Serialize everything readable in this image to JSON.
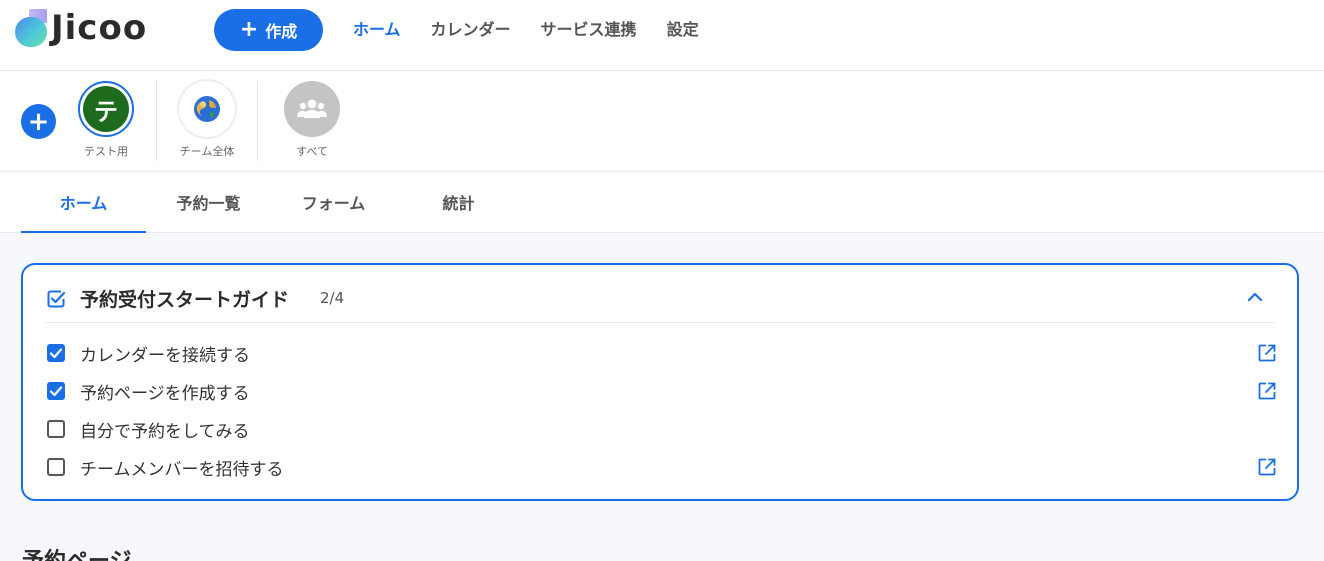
{
  "app": {
    "brand": "Jicoo",
    "accent": "#1b6fe6"
  },
  "header": {
    "create_label": "作成",
    "nav": [
      "ホーム",
      "カレンダー",
      "サービス連携",
      "設定"
    ],
    "active_nav": "ホーム"
  },
  "teams": {
    "items": [
      {
        "label": "テスト用",
        "initial": "テ",
        "color": "#1e6b1e",
        "selected": true
      },
      {
        "label": "チーム全体",
        "icon": "globe-icon"
      },
      {
        "label": "すべて",
        "icon": "group-icon"
      }
    ]
  },
  "tabs": {
    "items": [
      "ホーム",
      "予約一覧",
      "フォーム",
      "統計"
    ],
    "active": "ホーム"
  },
  "guide": {
    "title": "予約受付スタートガイド",
    "progress": "2/4",
    "tasks": [
      {
        "label": "カレンダーを接続する",
        "done": true,
        "has_link": true
      },
      {
        "label": "予約ページを作成する",
        "done": true,
        "has_link": true
      },
      {
        "label": "自分で予約をしてみる",
        "done": false,
        "has_link": false
      },
      {
        "label": "チームメンバーを招待する",
        "done": false,
        "has_link": true
      }
    ]
  },
  "sections": {
    "booking_pages_heading": "予約ページ"
  }
}
